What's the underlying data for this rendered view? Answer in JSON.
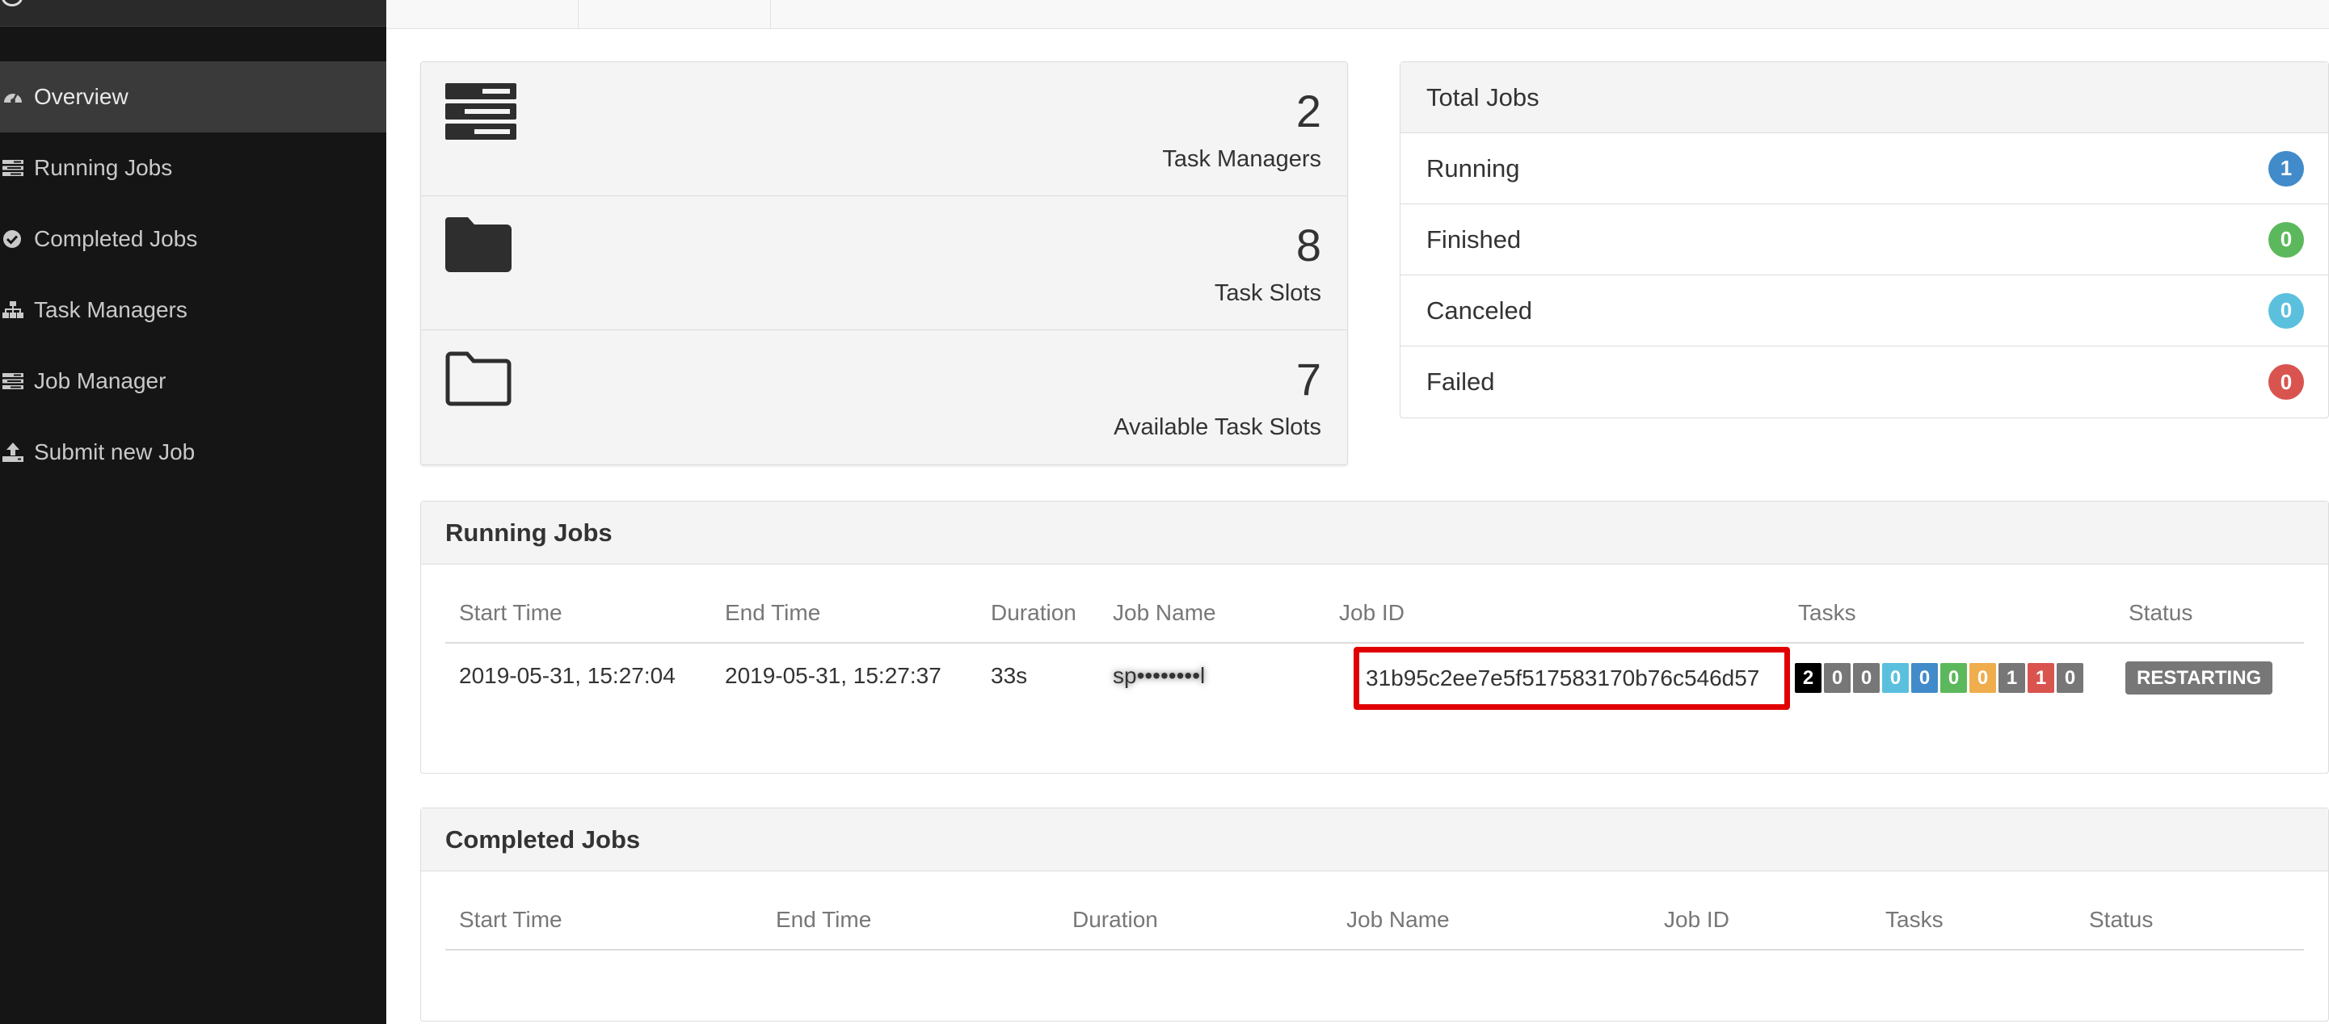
{
  "sidebar": {
    "items": [
      {
        "label": "Overview",
        "active": true
      },
      {
        "label": "Running Jobs"
      },
      {
        "label": "Completed Jobs"
      },
      {
        "label": "Task Managers"
      },
      {
        "label": "Job Manager"
      },
      {
        "label": "Submit new Job"
      }
    ]
  },
  "stats": [
    {
      "value": "2",
      "label": "Task Managers",
      "icon": "server-icon"
    },
    {
      "value": "8",
      "label": "Task Slots",
      "icon": "folder-icon"
    },
    {
      "value": "7",
      "label": "Available Task Slots",
      "icon": "folder-open-icon"
    }
  ],
  "total_jobs": {
    "title": "Total Jobs",
    "rows": [
      {
        "label": "Running",
        "count": "1",
        "color": "#428bca"
      },
      {
        "label": "Finished",
        "count": "0",
        "color": "#5cb85c"
      },
      {
        "label": "Canceled",
        "count": "0",
        "color": "#5bc0de"
      },
      {
        "label": "Failed",
        "count": "0",
        "color": "#d9534f"
      }
    ]
  },
  "running_jobs": {
    "title": "Running Jobs",
    "headers": [
      "Start Time",
      "End Time",
      "Duration",
      "Job Name",
      "Job ID",
      "Tasks",
      "Status"
    ],
    "rows": [
      {
        "start_time": "2019-05-31, 15:27:04",
        "end_time": "2019-05-31, 15:27:37",
        "duration": "33s",
        "job_name": "sp••••••••l",
        "job_id": "31b95c2ee7e5f517583170b76c546d57",
        "tasks": [
          {
            "count": "2",
            "color": "#000000"
          },
          {
            "count": "0",
            "color": "#777777"
          },
          {
            "count": "0",
            "color": "#777777"
          },
          {
            "count": "0",
            "color": "#5bc0de"
          },
          {
            "count": "0",
            "color": "#428bca"
          },
          {
            "count": "0",
            "color": "#5cb85c"
          },
          {
            "count": "0",
            "color": "#f0ad4e"
          },
          {
            "count": "1",
            "color": "#777777"
          },
          {
            "count": "1",
            "color": "#d9534f"
          },
          {
            "count": "0",
            "color": "#777777"
          }
        ],
        "status": "RESTARTING"
      }
    ]
  },
  "completed_jobs": {
    "title": "Completed Jobs",
    "headers": [
      "Start Time",
      "End Time",
      "Duration",
      "Job Name",
      "Job ID",
      "Tasks",
      "Status"
    ]
  }
}
